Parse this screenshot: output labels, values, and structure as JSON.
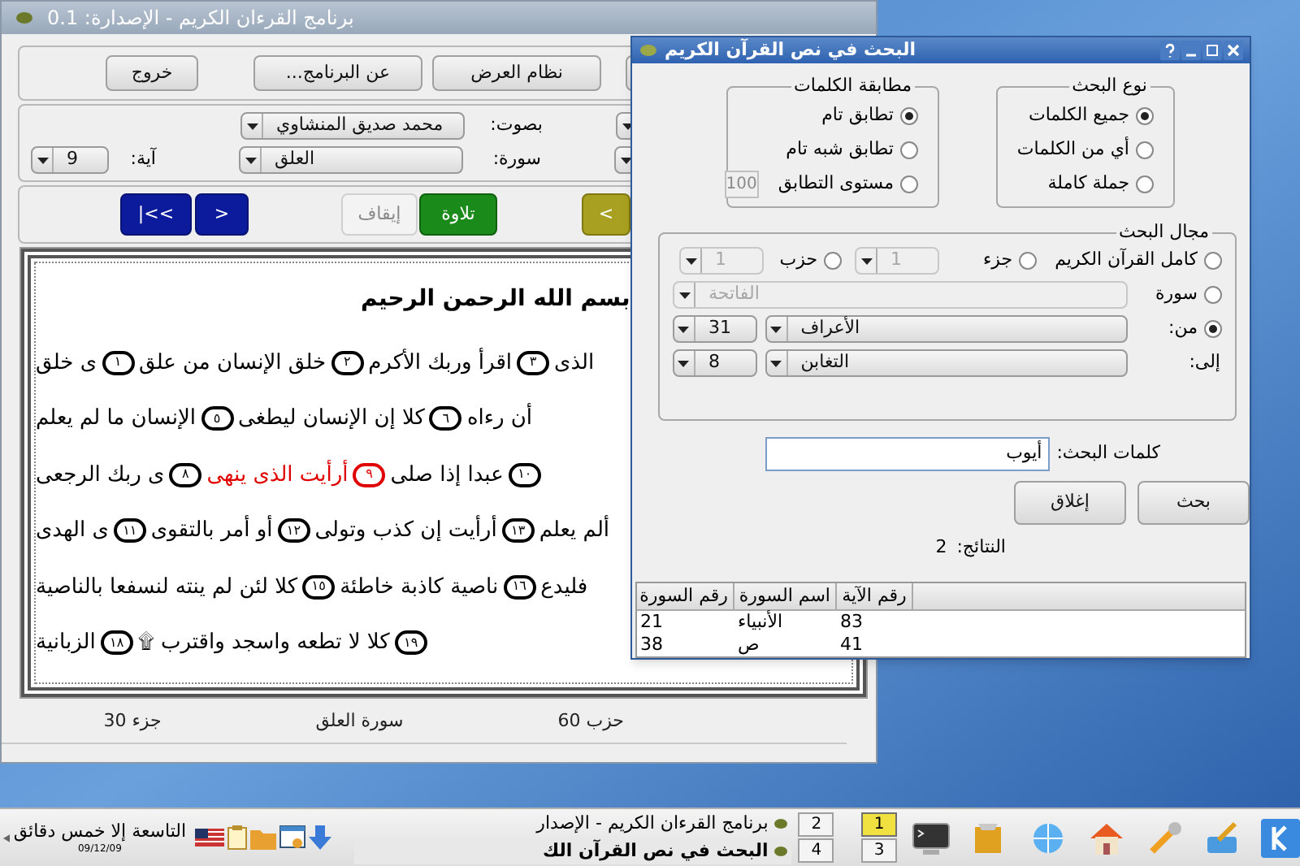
{
  "main_window": {
    "title": "برنامج القرءان الكريم - الإصدارة: 0.1",
    "toolbar_buttons": [
      "نظام العرض",
      "عن البرنامج...",
      "خروج"
    ],
    "reciter": {
      "label": "بصوت:",
      "value": "محمد صديق المنشاوي"
    },
    "surah": {
      "label": "سورة:",
      "value": "العلق"
    },
    "ayah": {
      "label": "آية:",
      "value": "9"
    },
    "playback_buttons": [
      {
        "text": "<",
        "kind": "back",
        "disabled": false
      },
      {
        "text": "تلاوة",
        "kind": "play",
        "disabled": false
      },
      {
        "text": "إيقاف",
        "kind": "stop",
        "disabled": true
      },
      {
        "text": ">",
        "kind": "nav",
        "disabled": false
      },
      {
        "text": "|<<",
        "kind": "nav",
        "disabled": false
      }
    ],
    "quran_page": {
      "bismillah": "بسم الله الرحمن الرحيم",
      "lines": [
        {
          "items": [
            {
              "kind": "text",
              "text": "الذى",
              "highlighted": false
            },
            {
              "kind": "ayah",
              "text": "٣",
              "highlighted": false
            },
            {
              "kind": "text",
              "text": "اقرأ وربك الأكرم",
              "highlighted": false
            },
            {
              "kind": "ayah",
              "text": "٢",
              "highlighted": false
            },
            {
              "kind": "text",
              "text": "خلق الإنسان من علق",
              "highlighted": false
            },
            {
              "kind": "ayah",
              "text": "١",
              "highlighted": false
            },
            {
              "kind": "text",
              "text": "ى خلق",
              "highlighted": false
            }
          ]
        },
        {
          "items": [
            {
              "kind": "text",
              "text": "أن رءاه",
              "highlighted": false
            },
            {
              "kind": "ayah",
              "text": "٦",
              "highlighted": false
            },
            {
              "kind": "text",
              "text": "كلا إن الإنسان ليطغى",
              "highlighted": false
            },
            {
              "kind": "ayah",
              "text": "٥",
              "highlighted": false
            },
            {
              "kind": "text",
              "text": "الإنسان ما لم يعلم",
              "highlighted": false
            }
          ]
        },
        {
          "items": [
            {
              "kind": "ayah",
              "text": "١٠",
              "highlighted": false
            },
            {
              "kind": "text",
              "text": "عبدا إذا صلى",
              "highlighted": false
            },
            {
              "kind": "ayah",
              "text": "٩",
              "highlighted": true
            },
            {
              "kind": "text",
              "text": "أرأيت الذى ينهى",
              "highlighted": true
            },
            {
              "kind": "ayah",
              "text": "٨",
              "highlighted": false
            },
            {
              "kind": "text",
              "text": "ى ربك الرجعى",
              "highlighted": false
            }
          ]
        },
        {
          "items": [
            {
              "kind": "text",
              "text": "ألم يعلم",
              "highlighted": false
            },
            {
              "kind": "ayah",
              "text": "١٣",
              "highlighted": false
            },
            {
              "kind": "text",
              "text": "أرأيت إن كذب وتولى",
              "highlighted": false
            },
            {
              "kind": "ayah",
              "text": "١٢",
              "highlighted": false
            },
            {
              "kind": "text",
              "text": "أو أمر بالتقوى",
              "highlighted": false
            },
            {
              "kind": "ayah",
              "text": "١١",
              "highlighted": false
            },
            {
              "kind": "text",
              "text": "ى الهدى",
              "highlighted": false
            }
          ]
        },
        {
          "items": [
            {
              "kind": "text",
              "text": "فليدع",
              "highlighted": false
            },
            {
              "kind": "ayah",
              "text": "١٦",
              "highlighted": false
            },
            {
              "kind": "text",
              "text": "ناصية كاذبة خاطئة",
              "highlighted": false
            },
            {
              "kind": "ayah",
              "text": "١٥",
              "highlighted": false
            },
            {
              "kind": "text",
              "text": "كلا لئن لم ينته لنسفعا بالناصية",
              "highlighted": false
            }
          ]
        },
        {
          "items": [
            {
              "kind": "ayah",
              "text": "١٩",
              "highlighted": false
            },
            {
              "kind": "text",
              "text": "كلا لا تطعه واسجد واقترب ۩",
              "highlighted": false
            },
            {
              "kind": "ayah",
              "text": "١٨",
              "highlighted": false
            },
            {
              "kind": "text",
              "text": "الزبانية",
              "highlighted": false
            }
          ]
        }
      ]
    },
    "status_bar": [
      "حزب 60",
      "سورة العلق",
      "جزء 30"
    ]
  },
  "search_dialog": {
    "title": "البحث في نص القرآن الكريم",
    "word_matching": {
      "title": "مطابقة الكلمات",
      "options": [
        {
          "label": "تطابق تام",
          "selected": true
        },
        {
          "label": "تطابق شبه تام",
          "selected": false
        },
        {
          "label": "مستوى التطابق",
          "selected": false
        }
      ],
      "match_level": {
        "value": "100",
        "disabled": true
      }
    },
    "search_type": {
      "title": "نوع البحث",
      "options": [
        {
          "label": "جميع الكلمات",
          "selected": true
        },
        {
          "label": "أي من الكلمات",
          "selected": false
        },
        {
          "label": "جملة كاملة",
          "selected": false
        }
      ]
    },
    "search_scope": {
      "title": "مجال البحث",
      "options": [
        {
          "label": "كامل القرآن الكريم",
          "selected": false
        },
        {
          "label": "جزء",
          "selected": false
        },
        {
          "label": "حزب",
          "selected": false
        },
        {
          "label": "سورة",
          "selected": false
        },
        {
          "label": "من:",
          "selected": true
        }
      ],
      "juz": {
        "value": "1",
        "disabled": true
      },
      "hizb": {
        "value": "1",
        "disabled": true
      },
      "surah": {
        "value": "الفاتحة",
        "disabled": true
      },
      "from": {
        "surah": "الأعراف",
        "ayah": "31"
      },
      "to": {
        "label": "إلى:",
        "surah": "التغابن",
        "ayah": "8"
      }
    },
    "search_words": {
      "label": "كلمات البحث:",
      "value": "أيوب"
    },
    "buttons": [
      "بحث",
      "إغلاق"
    ],
    "results": {
      "label": "النتائج:",
      "count": "2"
    },
    "table": {
      "columns": [
        "رقم الآية",
        "اسم السورة",
        "رقم السورة"
      ],
      "rows": [
        [
          "83",
          "الأنبياء",
          "21"
        ],
        [
          "41",
          "ص",
          "38"
        ]
      ]
    }
  },
  "taskbar": {
    "clock": {
      "time": "التاسعة إلا خمس دقائق",
      "date": "09/12/09"
    },
    "tasks": [
      {
        "title": "برنامج القرءان الكريم - الإصدار",
        "selected": false
      },
      {
        "title": "البحث في نص القرآن الك",
        "selected": true
      }
    ],
    "pager": [
      {
        "label": "1",
        "selected": true
      },
      {
        "label": "2",
        "selected": false
      },
      {
        "label": "3",
        "selected": false
      },
      {
        "label": "4",
        "selected": false
      }
    ]
  }
}
